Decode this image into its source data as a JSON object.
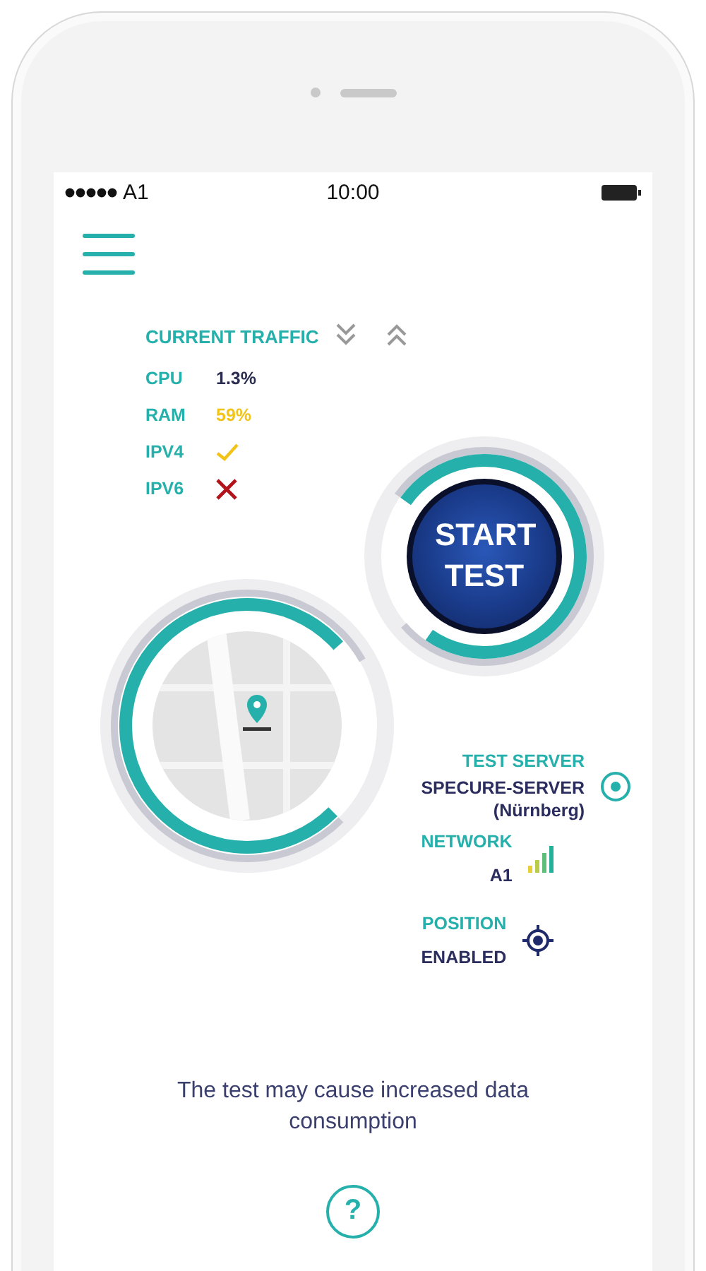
{
  "status_bar": {
    "carrier": "A1",
    "time": "10:00"
  },
  "traffic": {
    "title": "CURRENT TRAFFIC",
    "rows": [
      {
        "label": "CPU",
        "kind": "text",
        "value": "1.3%",
        "color": "#2b2d4e"
      },
      {
        "label": "RAM",
        "kind": "text",
        "value": "59%",
        "color": "#f2c318"
      },
      {
        "label": "IPV4",
        "kind": "check",
        "color": "#f2c318"
      },
      {
        "label": "IPV6",
        "kind": "cross",
        "color": "#b3141c"
      }
    ]
  },
  "start_button": {
    "label": "START TEST"
  },
  "info": [
    {
      "kind": "server",
      "label": "TEST SERVER",
      "value": "SPECURE-SERVER",
      "detail": "(Nürnberg)"
    },
    {
      "kind": "network",
      "label": "NETWORK",
      "value": "A1"
    },
    {
      "kind": "position",
      "label": "POSITION",
      "value": "ENABLED"
    }
  ],
  "notice": "The test may cause increased data consumption",
  "help_button": {
    "label": "?"
  }
}
